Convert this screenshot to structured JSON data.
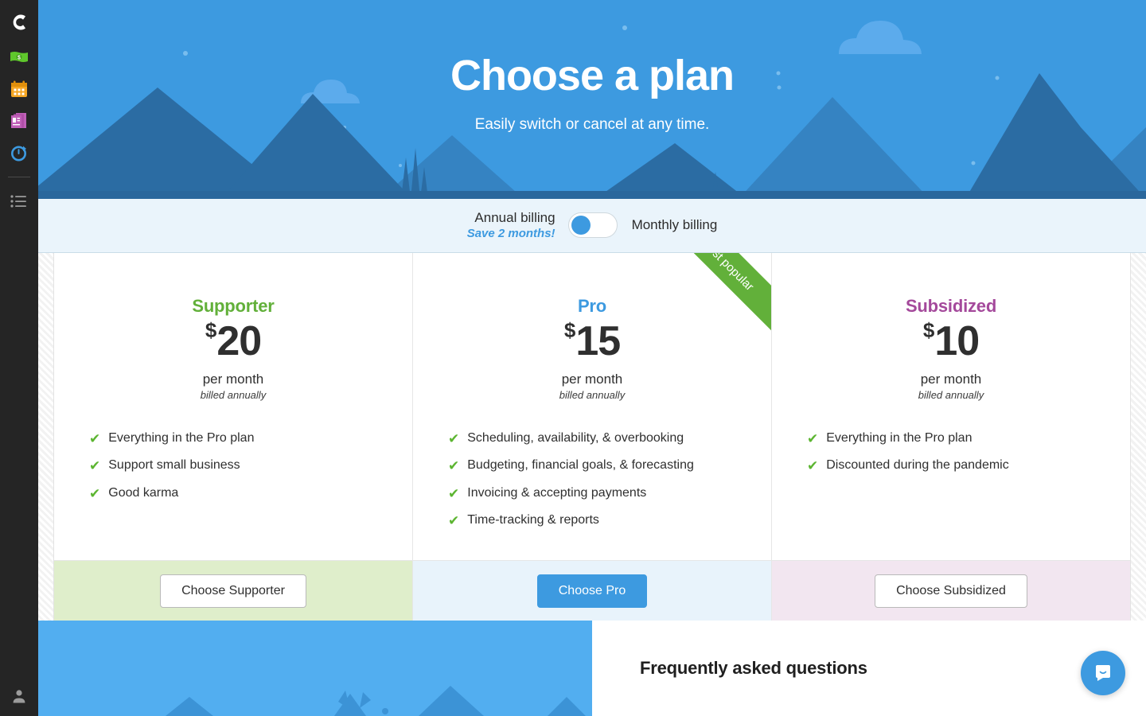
{
  "sidebar": {
    "logo_label": "C",
    "items": [
      {
        "name": "money-icon",
        "label": "Money"
      },
      {
        "name": "calendar-icon",
        "label": "Calendar"
      },
      {
        "name": "invoices-icon",
        "label": "Invoices"
      },
      {
        "name": "time-tracking-icon",
        "label": "Time tracking"
      },
      {
        "name": "list-icon",
        "label": "Tasks"
      }
    ],
    "account_label": "Account"
  },
  "hero": {
    "title": "Choose a plan",
    "subtitle": "Easily switch or cancel at any time.",
    "sky_color": "#3d9ae0",
    "mountain_dark": "#2b6ca3",
    "mountain_mid": "#3583c2",
    "cloud_color": "#59aaea"
  },
  "billing": {
    "annual_label": "Annual billing",
    "annual_note": "Save 2 months!",
    "monthly_label": "Monthly billing",
    "selected": "annual",
    "toggle_knob_color": "#3d9ae0"
  },
  "plans": [
    {
      "name": "Supporter",
      "name_color": "#62b03a",
      "currency": "$",
      "amount": "20",
      "period": "per month",
      "billing_note": "billed annually",
      "features": [
        "Everything in the Pro plan",
        "Support small business",
        "Good karma"
      ],
      "cta_label": "Choose Supporter",
      "cta_style": "outline",
      "footer_color": "#dfeecb",
      "ribbon": null
    },
    {
      "name": "Pro",
      "name_color": "#3d9ae0",
      "currency": "$",
      "amount": "15",
      "period": "per month",
      "billing_note": "billed annually",
      "features": [
        "Scheduling, availability, & overbooking",
        "Budgeting, financial goals, & forecasting",
        "Invoicing & accepting payments",
        "Time-tracking & reports"
      ],
      "cta_label": "Choose Pro",
      "cta_style": "primary",
      "footer_color": "#e8f3fb",
      "ribbon": "Most popular"
    },
    {
      "name": "Subsidized",
      "name_color": "#a4499b",
      "currency": "$",
      "amount": "10",
      "period": "per month",
      "billing_note": "billed annually",
      "features": [
        "Everything in the Pro plan",
        "Discounted during the pandemic"
      ],
      "cta_label": "Choose Subsidized",
      "cta_style": "outline",
      "footer_color": "#f2e6f0",
      "ribbon": null
    }
  ],
  "faq": {
    "title": "Frequently asked questions"
  },
  "support": {
    "chat_label": "Open chat"
  },
  "colors": {
    "accent_blue": "#3d9ae0",
    "accent_green": "#62b03a",
    "accent_purple": "#a4499b",
    "sidebar_bg": "#252525",
    "billing_bar_bg": "#eaf4fb"
  }
}
